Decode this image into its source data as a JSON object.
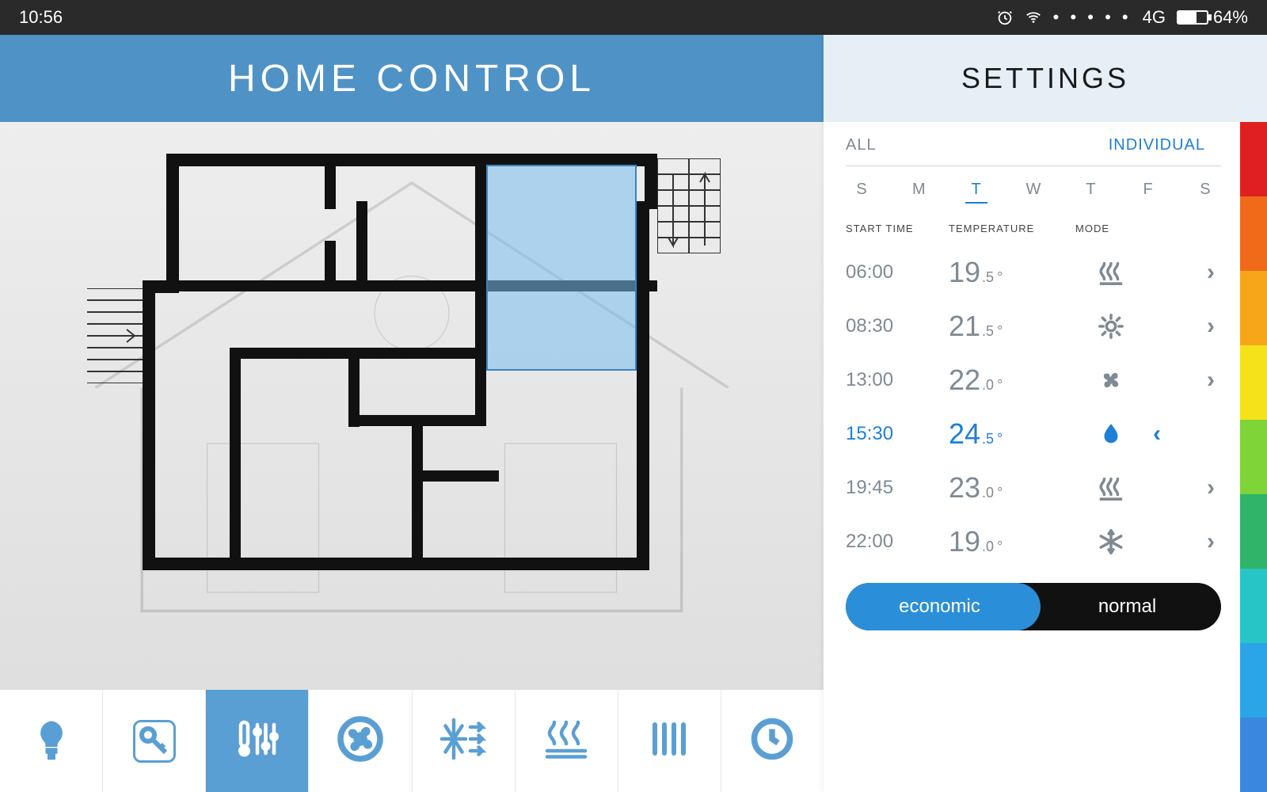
{
  "status": {
    "time": "10:56",
    "network": "4G",
    "battery_pct": "64%",
    "battery_fill": 64
  },
  "header": {
    "title": "HOME CONTROL"
  },
  "settings": {
    "title": "SETTINGS",
    "tabs": {
      "all": "ALL",
      "individual": "INDIVIDUAL",
      "active": "individual"
    },
    "days": [
      "S",
      "M",
      "T",
      "W",
      "T",
      "F",
      "S"
    ],
    "active_day_index": 2,
    "headers": {
      "start_time": "START TIME",
      "temperature": "TEMPERATURE",
      "mode": "MODE"
    },
    "schedule": [
      {
        "time": "06:00",
        "temp_whole": "19",
        "temp_dec": ".5",
        "mode": "heat-waves",
        "active": false
      },
      {
        "time": "08:30",
        "temp_whole": "21",
        "temp_dec": ".5",
        "mode": "sun",
        "active": false
      },
      {
        "time": "13:00",
        "temp_whole": "22",
        "temp_dec": ".0",
        "mode": "fan",
        "active": false
      },
      {
        "time": "15:30",
        "temp_whole": "24",
        "temp_dec": ".5",
        "mode": "water-drop",
        "active": true
      },
      {
        "time": "19:45",
        "temp_whole": "23",
        "temp_dec": ".0",
        "mode": "heat-waves",
        "active": false
      },
      {
        "time": "22:00",
        "temp_whole": "19",
        "temp_dec": ".0",
        "mode": "snowflake",
        "active": false
      }
    ],
    "toggle": {
      "left": "economic",
      "right": "normal",
      "active": "economic"
    },
    "color_scale": [
      "#e02020",
      "#f06a1a",
      "#f7a61a",
      "#f6e21a",
      "#7fd438",
      "#2fb46a",
      "#27c5c5",
      "#2aa6e8",
      "#3a87e0"
    ]
  },
  "bottom_icons": [
    {
      "name": "light-icon",
      "active": false
    },
    {
      "name": "key-icon",
      "active": false
    },
    {
      "name": "thermostat-icon",
      "active": true
    },
    {
      "name": "fan-icon",
      "active": false
    },
    {
      "name": "ac-icon",
      "active": false
    },
    {
      "name": "floor-heat-icon",
      "active": false
    },
    {
      "name": "radiator-icon",
      "active": false
    },
    {
      "name": "clock-icon",
      "active": false
    }
  ],
  "colors": {
    "accent": "#1e7fd6",
    "header_band": "#4f92c6"
  }
}
